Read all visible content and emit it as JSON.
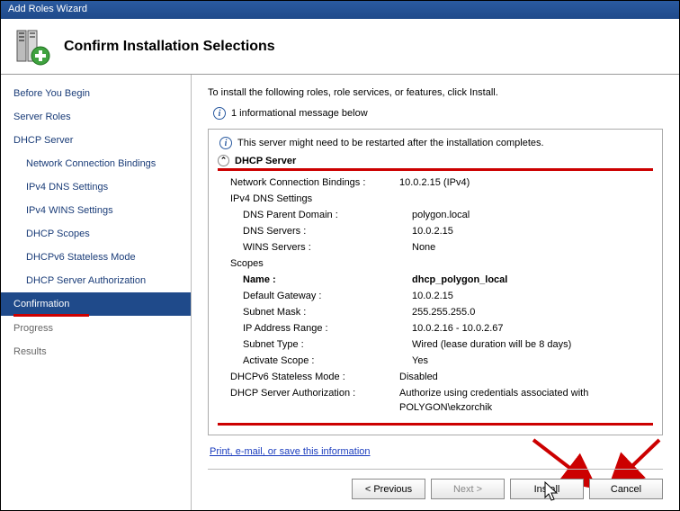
{
  "titlebar": "Add Roles Wizard",
  "header": {
    "title": "Confirm Installation Selections"
  },
  "sidebar": {
    "items": [
      {
        "label": "Before You Begin"
      },
      {
        "label": "Server Roles"
      },
      {
        "label": "DHCP Server"
      },
      {
        "label": "Network Connection Bindings",
        "sub": true
      },
      {
        "label": "IPv4 DNS Settings",
        "sub": true
      },
      {
        "label": "IPv4 WINS Settings",
        "sub": true
      },
      {
        "label": "DHCP Scopes",
        "sub": true
      },
      {
        "label": "DHCPv6 Stateless Mode",
        "sub": true
      },
      {
        "label": "DHCP Server Authorization",
        "sub": true
      },
      {
        "label": "Confirmation",
        "selected": true
      },
      {
        "label": "Progress",
        "muted": true
      },
      {
        "label": "Results",
        "muted": true
      }
    ]
  },
  "main": {
    "instruction": "To install the following roles, role services, or features, click Install.",
    "info_message": "1 informational message below",
    "restart_warning": "This server might need to be restarted after the installation completes.",
    "role_header": "DHCP Server",
    "rows": [
      {
        "k": "Network Connection Bindings :",
        "v": "10.0.2.15 (IPv4)",
        "cls": "sec"
      },
      {
        "k": "IPv4 DNS Settings",
        "v": "",
        "cls": "sec"
      },
      {
        "k": "DNS Parent Domain :",
        "v": "polygon.local",
        "cls": "sub"
      },
      {
        "k": "DNS Servers :",
        "v": "10.0.2.15",
        "cls": "sub"
      },
      {
        "k": "WINS Servers :",
        "v": "None",
        "cls": "sub"
      },
      {
        "k": "Scopes",
        "v": "",
        "cls": "sec"
      },
      {
        "k": "Name :",
        "v": "dhcp_polygon_local",
        "cls": "sub bold"
      },
      {
        "k": "Default Gateway :",
        "v": "10.0.2.15",
        "cls": "sub"
      },
      {
        "k": "Subnet Mask :",
        "v": "255.255.255.0",
        "cls": "sub"
      },
      {
        "k": "IP Address Range :",
        "v": "10.0.2.16 - 10.0.2.67",
        "cls": "sub"
      },
      {
        "k": "Subnet Type :",
        "v": "Wired (lease duration will be 8 days)",
        "cls": "sub"
      },
      {
        "k": "Activate Scope :",
        "v": "Yes",
        "cls": "sub"
      },
      {
        "k": "DHCPv6 Stateless Mode :",
        "v": "Disabled",
        "cls": "sec"
      },
      {
        "k": "DHCP Server Authorization :",
        "v": "Authorize using credentials associated with POLYGON\\ekzorchik",
        "cls": "sec"
      }
    ],
    "link": "Print, e-mail, or save this information"
  },
  "buttons": {
    "previous": "< Previous",
    "next": "Next >",
    "install": "Install",
    "cancel": "Cancel"
  }
}
